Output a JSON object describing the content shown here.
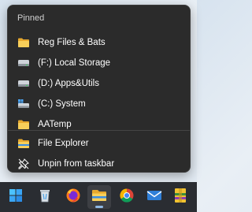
{
  "jumplist": {
    "pinned_header": "Pinned",
    "pinned_items": [
      {
        "label": "Reg Files & Bats",
        "icon": "folder-icon"
      },
      {
        "label": "(F:) Local Storage",
        "icon": "drive-icon"
      },
      {
        "label": "(D:) Apps&Utils",
        "icon": "drive-icon"
      },
      {
        "label": "(C:) System",
        "icon": "system-drive-icon"
      },
      {
        "label": "AATemp",
        "icon": "folder-icon"
      }
    ],
    "actions": [
      {
        "label": "File Explorer",
        "icon": "file-explorer-icon"
      },
      {
        "label": "Unpin from taskbar",
        "icon": "unpin-icon"
      }
    ]
  },
  "taskbar": {
    "apps": [
      {
        "name": "start-button",
        "icon": "windows-logo-icon"
      },
      {
        "name": "recycle-bin",
        "icon": "recycle-bin-icon"
      },
      {
        "name": "firefox",
        "icon": "firefox-icon"
      },
      {
        "name": "file-explorer",
        "icon": "file-explorer-icon",
        "active": true
      },
      {
        "name": "chrome",
        "icon": "chrome-icon"
      },
      {
        "name": "mail",
        "icon": "mail-icon"
      },
      {
        "name": "winrar",
        "icon": "winrar-icon"
      }
    ]
  },
  "colors": {
    "menu_bg": "#2b2b2b",
    "taskbar_bg": "#2a2d32",
    "folder_yellow": "#f4c84a",
    "active_indicator": "#8fb8e4"
  }
}
